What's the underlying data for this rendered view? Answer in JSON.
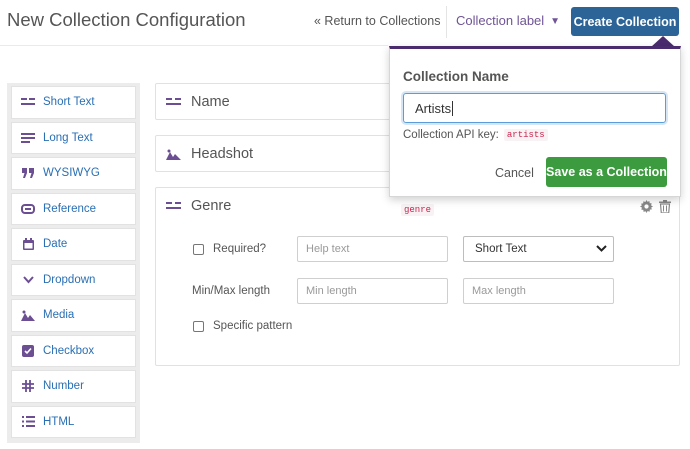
{
  "header": {
    "title": "New Collection Configuration",
    "return_link": "« Return to Collections",
    "label_dropdown": "Collection label",
    "create_button": "Create Collection"
  },
  "palette": {
    "items": [
      {
        "label": "Short Text",
        "icon": "short-text-icon"
      },
      {
        "label": "Long Text",
        "icon": "long-text-icon"
      },
      {
        "label": "WYSIWYG",
        "icon": "quote-icon"
      },
      {
        "label": "Reference",
        "icon": "link-icon"
      },
      {
        "label": "Date",
        "icon": "calendar-icon"
      },
      {
        "label": "Dropdown",
        "icon": "chevron-down-icon"
      },
      {
        "label": "Media",
        "icon": "image-icon"
      },
      {
        "label": "Checkbox",
        "icon": "checkbox-icon"
      },
      {
        "label": "Number",
        "icon": "hash-icon"
      },
      {
        "label": "HTML",
        "icon": "list-icon"
      }
    ]
  },
  "fields": {
    "name": {
      "label": "Name",
      "icon": "short-text-icon"
    },
    "headshot": {
      "label": "Headshot",
      "icon": "image-icon"
    },
    "genre": {
      "label": "Genre",
      "icon": "short-text-icon",
      "api_key": "genre",
      "required_label": "Required?",
      "help_placeholder": "Help text",
      "type_value": "Short Text",
      "minmax_label": "Min/Max length",
      "min_placeholder": "Min length",
      "max_placeholder": "Max length",
      "pattern_label": "Specific pattern"
    }
  },
  "popover": {
    "title": "Collection Name",
    "name_value": "Artists",
    "api_label": "Collection API key:",
    "api_value": "artists",
    "cancel": "Cancel",
    "save": "Save as a Collection"
  },
  "colors": {
    "primary": "#2d6497",
    "accent": "#6c4e93",
    "save": "#3c9a3f",
    "link": "#2a6fb3",
    "code": "#c7254e"
  }
}
